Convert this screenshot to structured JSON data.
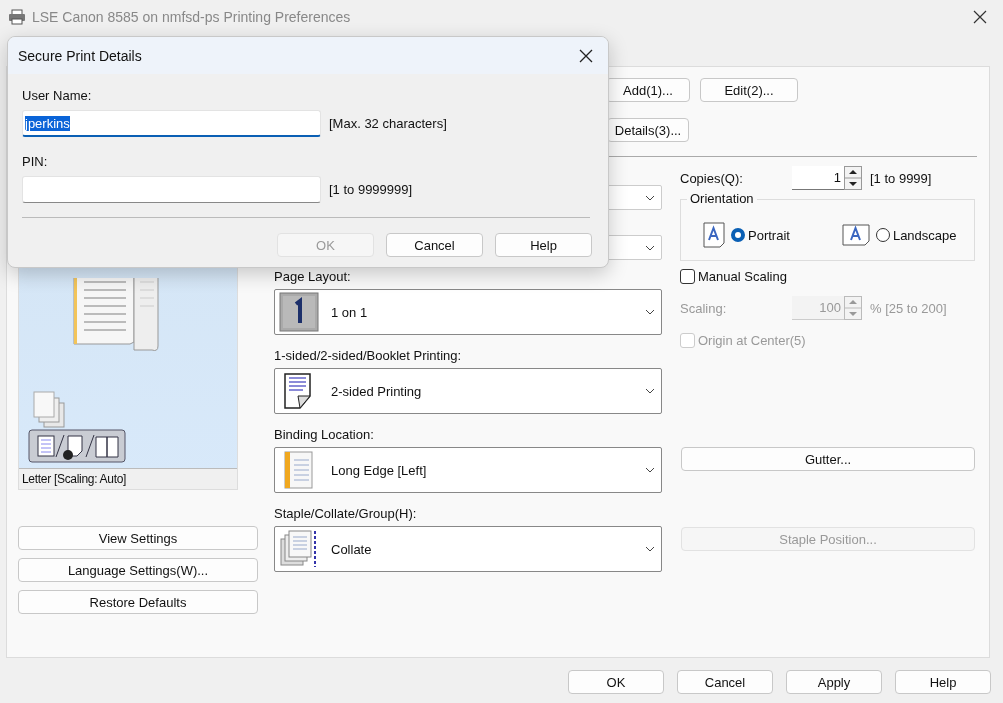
{
  "window": {
    "title": "LSE Canon 8585 on nmfsd-ps Printing Preferences"
  },
  "profile_buttons": [
    {
      "label": "Add(1)..."
    },
    {
      "label": "Edit(2)..."
    },
    {
      "label": "Details(3)..."
    }
  ],
  "preview": {
    "caption": "Letter [Scaling: Auto]"
  },
  "left_buttons": [
    "View Settings",
    "Language Settings(W)...",
    "Restore Defaults"
  ],
  "settings": [
    {
      "label": "Page Layout:",
      "value": "1 on 1",
      "kind": "nup"
    },
    {
      "label": "1-sided/2-sided/Booklet Printing:",
      "value": "2-sided Printing",
      "kind": "duplex"
    },
    {
      "label": "Binding Location:",
      "value": "Long Edge [Left]",
      "kind": "binding"
    },
    {
      "label": "Staple/Collate/Group(H):",
      "value": "Collate",
      "kind": "collate"
    }
  ],
  "copies": {
    "label": "Copies(Q):",
    "value": "1",
    "range": "[1 to 9999]"
  },
  "orientation": {
    "title": "Orientation",
    "options": [
      {
        "label": "Portrait",
        "selected": true,
        "kind": "portrait"
      },
      {
        "label": "Landscape",
        "selected": false,
        "kind": "landscape"
      }
    ]
  },
  "manual_scaling": {
    "label": "Manual Scaling",
    "checked": false
  },
  "scaling": {
    "label": "Scaling:",
    "value": "100",
    "range": "% [25 to 200]",
    "disabled": true
  },
  "origin_at_center": {
    "label": "Origin at Center(5)",
    "checked": false,
    "disabled": true
  },
  "side_buttons": [
    {
      "label": "Gutter...",
      "disabled": false
    },
    {
      "label": "Staple Position...",
      "disabled": true
    }
  ],
  "footer_buttons": [
    "OK",
    "Cancel",
    "Apply",
    "Help"
  ],
  "dialog": {
    "title": "Secure Print Details",
    "fields": [
      {
        "label": "User Name:",
        "value": "jperkins",
        "hint": "[Max. 32 characters]",
        "focused": true
      },
      {
        "label": "PIN:",
        "hint": "[1 to 9999999]",
        "focused": false
      }
    ],
    "buttons": [
      {
        "label": "OK",
        "disabled": true
      },
      {
        "label": "Cancel",
        "disabled": false
      },
      {
        "label": "Help",
        "disabled": false
      }
    ]
  }
}
